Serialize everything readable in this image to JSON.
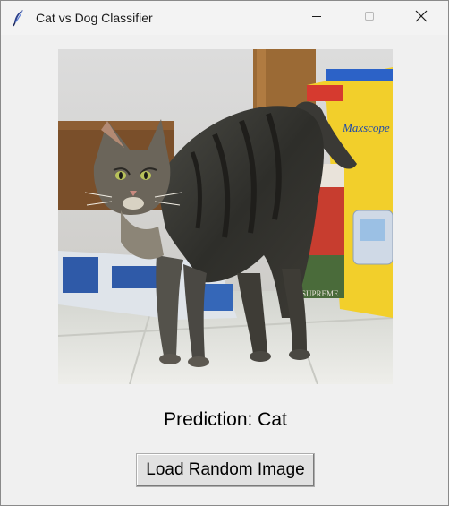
{
  "window": {
    "title": "Cat vs Dog Classifier",
    "app_icon": "feather-icon",
    "controls": {
      "minimize_icon": "minimize-icon",
      "maximize_icon": "maximize-icon",
      "close_icon": "close-icon"
    }
  },
  "main": {
    "image": {
      "subject": "cat-photo",
      "package_text": "Maxscope",
      "can_label": "SUPREME"
    },
    "prediction_text": "Prediction: Cat",
    "load_button_label": "Load Random Image"
  },
  "colors": {
    "background": "#f0f0f0",
    "button_face": "#e1e1e1",
    "text": "#000000"
  }
}
